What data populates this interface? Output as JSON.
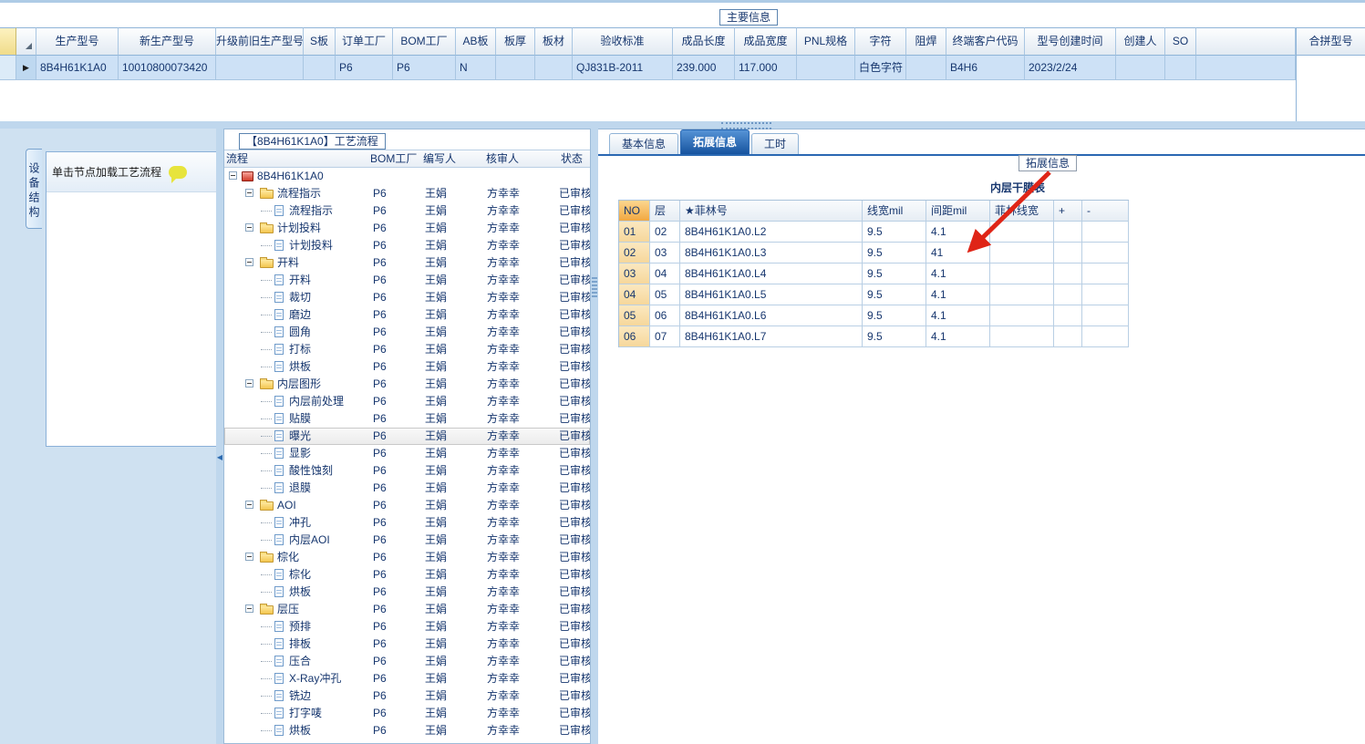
{
  "main_info": {
    "title": "主要信息",
    "merge_title": "合拼型号",
    "columns": [
      "生产型号",
      "新生产型号",
      "升级前旧生产型号",
      "S板",
      "订单工厂",
      "BOM工厂",
      "AB板",
      "板厚",
      "板材",
      "验收标准",
      "成品长度",
      "成品宽度",
      "PNL规格",
      "字符",
      "阻焊",
      "终端客户代码",
      "型号创建时间",
      "创建人",
      "SO"
    ],
    "row": [
      "8B4H61K1A0",
      "10010800073420",
      "",
      "",
      "P6",
      "P6",
      "N",
      "",
      "",
      "QJ831B-2011",
      "239.000",
      "117.000",
      "",
      "白色字符",
      "",
      "B4H6",
      "2023/2/24",
      "",
      ""
    ]
  },
  "left_panel": {
    "tab_label": "设备结构",
    "hint": "单击节点加载工艺流程"
  },
  "process_tree": {
    "title": "【8B4H61K1A0】工艺流程",
    "header": {
      "flow": "流程",
      "factory": "BOM工厂",
      "writer": "编写人",
      "reviewer": "核审人",
      "status": "状态"
    },
    "root_label": "8B4H61K1A0",
    "row_values": {
      "factory": "P6",
      "writer": "王娟",
      "reviewer": "方幸幸",
      "status": "已审核"
    },
    "nodes": [
      {
        "label": "流程指示",
        "kind": "folder"
      },
      {
        "label": "流程指示",
        "kind": "doc"
      },
      {
        "label": "计划投料",
        "kind": "folder"
      },
      {
        "label": "计划投料",
        "kind": "doc"
      },
      {
        "label": "开料",
        "kind": "folder"
      },
      {
        "label": "开料",
        "kind": "doc"
      },
      {
        "label": "裁切",
        "kind": "doc"
      },
      {
        "label": "磨边",
        "kind": "doc"
      },
      {
        "label": "圆角",
        "kind": "doc"
      },
      {
        "label": "打标",
        "kind": "doc"
      },
      {
        "label": "烘板",
        "kind": "doc"
      },
      {
        "label": "内层图形",
        "kind": "folder"
      },
      {
        "label": "内层前处理",
        "kind": "doc"
      },
      {
        "label": "贴膜",
        "kind": "doc"
      },
      {
        "label": "曝光",
        "kind": "doc",
        "selected": true
      },
      {
        "label": "显影",
        "kind": "doc"
      },
      {
        "label": "酸性蚀刻",
        "kind": "doc"
      },
      {
        "label": "退膜",
        "kind": "doc"
      },
      {
        "label": "AOI",
        "kind": "folder"
      },
      {
        "label": "冲孔",
        "kind": "doc"
      },
      {
        "label": "内层AOI",
        "kind": "doc"
      },
      {
        "label": "棕化",
        "kind": "folder"
      },
      {
        "label": "棕化",
        "kind": "doc"
      },
      {
        "label": "烘板",
        "kind": "doc"
      },
      {
        "label": "层压",
        "kind": "folder"
      },
      {
        "label": "预排",
        "kind": "doc"
      },
      {
        "label": "排板",
        "kind": "doc"
      },
      {
        "label": "压合",
        "kind": "doc"
      },
      {
        "label": "X-Ray冲孔",
        "kind": "doc"
      },
      {
        "label": "铣边",
        "kind": "doc"
      },
      {
        "label": "打字唛",
        "kind": "doc"
      },
      {
        "label": "烘板",
        "kind": "doc"
      }
    ]
  },
  "detail_panel": {
    "tabs": [
      "基本信息",
      "拓展信息",
      "工时"
    ],
    "active_tab_index": 1,
    "floating_label": "拓展信息",
    "table_title": "内层干膜表",
    "film_table": {
      "columns": [
        "NO",
        "层",
        "★菲林号",
        "线宽mil",
        "间距mil",
        "菲林线宽",
        "+",
        "-"
      ],
      "rows": [
        [
          "01",
          "02",
          "8B4H61K1A0.L2",
          "9.5",
          "4.1",
          "",
          "",
          ""
        ],
        [
          "02",
          "03",
          "8B4H61K1A0.L3",
          "9.5",
          "41",
          "",
          "",
          ""
        ],
        [
          "03",
          "04",
          "8B4H61K1A0.L4",
          "9.5",
          "4.1",
          "",
          "",
          ""
        ],
        [
          "04",
          "05",
          "8B4H61K1A0.L5",
          "9.5",
          "4.1",
          "",
          "",
          ""
        ],
        [
          "05",
          "06",
          "8B4H61K1A0.L6",
          "9.5",
          "4.1",
          "",
          "",
          ""
        ],
        [
          "06",
          "07",
          "8B4H61K1A0.L7",
          "9.5",
          "4.1",
          "",
          "",
          ""
        ]
      ]
    }
  },
  "icons": {
    "row_selector": "▶",
    "splitter_collapse": "◀"
  },
  "annotation": {
    "color": "#df2517"
  }
}
